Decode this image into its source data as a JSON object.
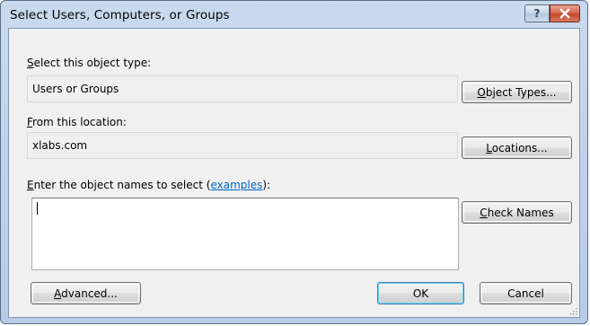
{
  "window": {
    "title": "Select Users, Computers, or Groups",
    "help_glyph": "?",
    "close_icon": "close-x-icon",
    "close_color": "#c9462c"
  },
  "object_type": {
    "label_prefix": "S",
    "label_rest": "elect this object type:",
    "value": "Users or Groups",
    "button_prefix": "O",
    "button_rest": "bject Types..."
  },
  "location": {
    "label_prefix": "F",
    "label_rest": "rom this location:",
    "value": "xlabs.com",
    "button_prefix": "L",
    "button_rest": "ocations..."
  },
  "names": {
    "label_prefix": "E",
    "label_rest": "nter the object names to select (",
    "link_text": "examples",
    "label_suffix": "):",
    "value": "",
    "check_button_prefix": "C",
    "check_button_rest": "heck Names"
  },
  "footer": {
    "advanced_prefix": "A",
    "advanced_rest": "dvanced...",
    "ok_label": "OK",
    "cancel_label": "Cancel"
  },
  "colors": {
    "link": "#0066cc",
    "frame": "#b7cbe6",
    "client": "#f0f0f0"
  }
}
